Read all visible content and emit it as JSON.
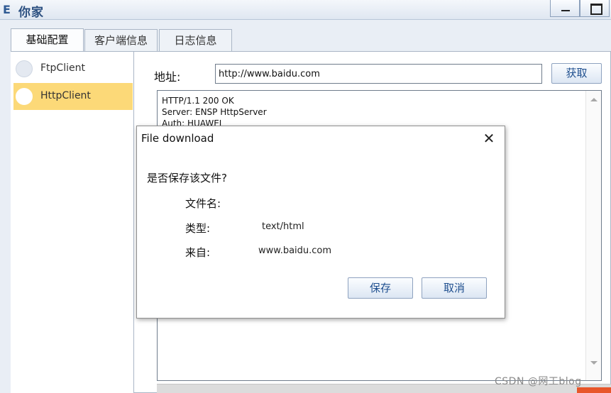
{
  "window": {
    "title": "你家",
    "icon": "app-logo-icon"
  },
  "tabs": [
    {
      "label": "基础配置",
      "active": true
    },
    {
      "label": "客户端信息",
      "active": false
    },
    {
      "label": "日志信息",
      "active": false
    }
  ],
  "clients": [
    {
      "label": "FtpClient",
      "selected": false
    },
    {
      "label": "HttpClient",
      "selected": true
    }
  ],
  "address": {
    "label": "地址:",
    "value": "http://www.baidu.com",
    "button": "获取"
  },
  "response": {
    "lines": [
      "HTTP/1.1 200 OK",
      "Server: ENSP HttpServer",
      "Auth: HUAWEI"
    ]
  },
  "dialog": {
    "title": "File download",
    "question": "是否保存该文件?",
    "fields": [
      {
        "label": "文件名:",
        "value": ""
      },
      {
        "label": "类型:",
        "value": "text/html"
      },
      {
        "label": "来自:",
        "value": "www.baidu.com"
      }
    ],
    "save_label": "保存",
    "cancel_label": "取消"
  },
  "watermark": "CSDN @网工blog",
  "colors": {
    "selected_item": "#fcd978",
    "button_text": "#1f4f8f"
  }
}
